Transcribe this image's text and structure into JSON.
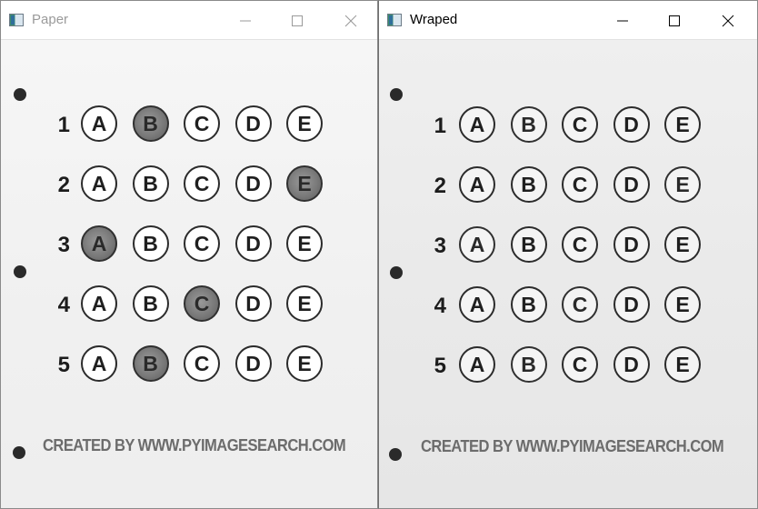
{
  "windows": {
    "paper": {
      "title": "Paper",
      "active": false
    },
    "wraped": {
      "title": "Wraped",
      "active": true
    }
  },
  "sheet": {
    "choices": [
      "A",
      "B",
      "C",
      "D",
      "E"
    ],
    "questions": [
      {
        "number": "1",
        "marked": "B"
      },
      {
        "number": "2",
        "marked": "E"
      },
      {
        "number": "3",
        "marked": "A"
      },
      {
        "number": "4",
        "marked": "C"
      },
      {
        "number": "5",
        "marked": "B"
      }
    ],
    "footer": "CREATED BY WWW.PYIMAGESEARCH.COM"
  },
  "icons": {
    "minimize": "minimize-icon",
    "maximize": "maximize-icon",
    "close": "close-icon",
    "app": "app-window-icon"
  }
}
